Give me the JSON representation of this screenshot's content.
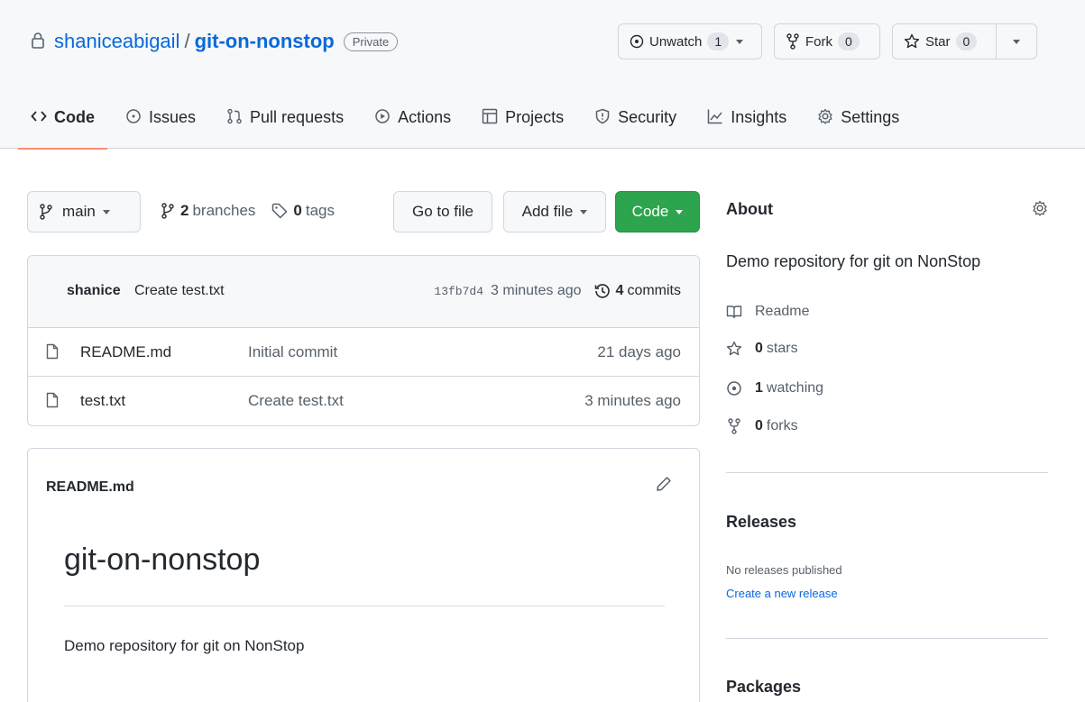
{
  "repo": {
    "owner": "shaniceabigail",
    "separator": "/",
    "name": "git-on-nonstop",
    "visibility": "Private"
  },
  "header_actions": {
    "watch_label": "Unwatch",
    "watch_count": "1",
    "fork_label": "Fork",
    "fork_count": "0",
    "star_label": "Star",
    "star_count": "0"
  },
  "tabs": [
    {
      "label": "Code",
      "icon": "code-icon",
      "selected": true
    },
    {
      "label": "Issues",
      "icon": "issue-icon"
    },
    {
      "label": "Pull requests",
      "icon": "pull-request-icon"
    },
    {
      "label": "Actions",
      "icon": "play-icon"
    },
    {
      "label": "Projects",
      "icon": "table-icon"
    },
    {
      "label": "Security",
      "icon": "shield-icon"
    },
    {
      "label": "Insights",
      "icon": "graph-icon"
    },
    {
      "label": "Settings",
      "icon": "gear-icon"
    }
  ],
  "branch_bar": {
    "branch": "main",
    "branches_count": "2",
    "branches_label": "branches",
    "tags_count": "0",
    "tags_label": "tags",
    "go_to_file": "Go to file",
    "add_file": "Add file",
    "code": "Code"
  },
  "latest_commit": {
    "author": "shanice",
    "message": "Create test.txt",
    "sha": "13fb7d4",
    "time": "3 minutes ago",
    "commits_count": "4",
    "commits_label": "commits"
  },
  "files": [
    {
      "name": "README.md",
      "message": "Initial commit",
      "date": "21 days ago"
    },
    {
      "name": "test.txt",
      "message": "Create test.txt",
      "date": "3 minutes ago"
    }
  ],
  "readme": {
    "filename": "README.md",
    "heading": "git-on-nonstop",
    "body": "Demo repository for git on NonStop"
  },
  "about": {
    "title": "About",
    "description": "Demo repository for git on NonStop",
    "readme_label": "Readme",
    "stars_count": "0",
    "stars_label": "stars",
    "watching_count": "1",
    "watching_label": "watching",
    "forks_count": "0",
    "forks_label": "forks"
  },
  "releases": {
    "title": "Releases",
    "empty_text": "No releases published",
    "create_link": "Create a new release"
  },
  "packages": {
    "title": "Packages"
  },
  "colors": {
    "link": "#0969da",
    "primary_button": "#2da44e",
    "tab_underline": "#fd8c73"
  }
}
